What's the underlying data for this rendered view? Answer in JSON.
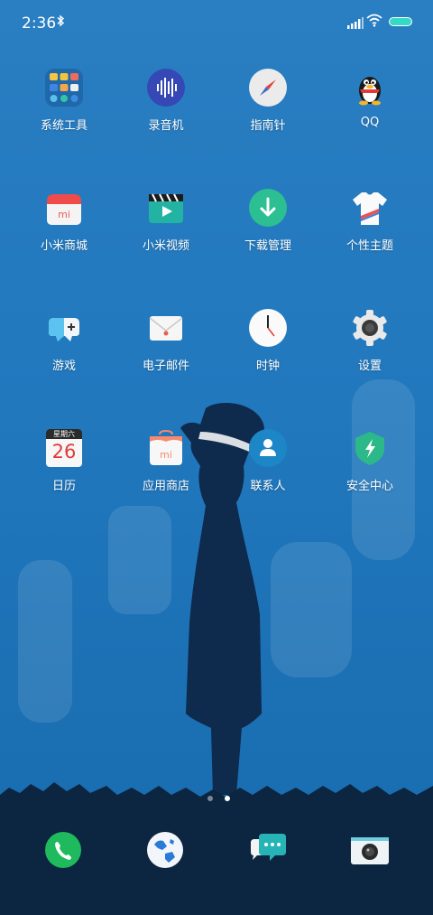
{
  "status_bar": {
    "time": "2:36",
    "bluetooth_icon": "bluetooth-icon",
    "signal_icon": "signal-icon",
    "wifi_icon": "wifi-icon",
    "battery_icon": "battery-icon"
  },
  "apps": [
    {
      "label": "系统工具",
      "icon": "system-tools-folder-icon"
    },
    {
      "label": "录音机",
      "icon": "sound-recorder-icon"
    },
    {
      "label": "指南针",
      "icon": "compass-icon"
    },
    {
      "label": "QQ",
      "icon": "qq-penguin-icon"
    },
    {
      "label": "小米商城",
      "icon": "mi-store-icon"
    },
    {
      "label": "小米视频",
      "icon": "mi-video-icon"
    },
    {
      "label": "下载管理",
      "icon": "download-manager-icon"
    },
    {
      "label": "个性主题",
      "icon": "themes-icon"
    },
    {
      "label": "游戏",
      "icon": "games-icon"
    },
    {
      "label": "电子邮件",
      "icon": "email-icon"
    },
    {
      "label": "时钟",
      "icon": "clock-icon"
    },
    {
      "label": "设置",
      "icon": "settings-gear-icon"
    },
    {
      "label": "日历",
      "icon": "calendar-icon"
    },
    {
      "label": "应用商店",
      "icon": "app-store-icon"
    },
    {
      "label": "联系人",
      "icon": "contacts-icon"
    },
    {
      "label": "安全中心",
      "icon": "security-center-icon"
    }
  ],
  "calendar": {
    "weekday": "星期六",
    "day": "26"
  },
  "page_indicator": {
    "pages": 2,
    "current": 2
  },
  "dock": [
    {
      "icon": "phone-icon"
    },
    {
      "icon": "browser-globe-icon"
    },
    {
      "icon": "messages-icon"
    },
    {
      "icon": "camera-icon"
    }
  ],
  "colors": {
    "wallpaper": "#2178bd",
    "silhouette": "#0e2a4c",
    "ground": "#0c2540",
    "battery": "#36d8c7"
  }
}
